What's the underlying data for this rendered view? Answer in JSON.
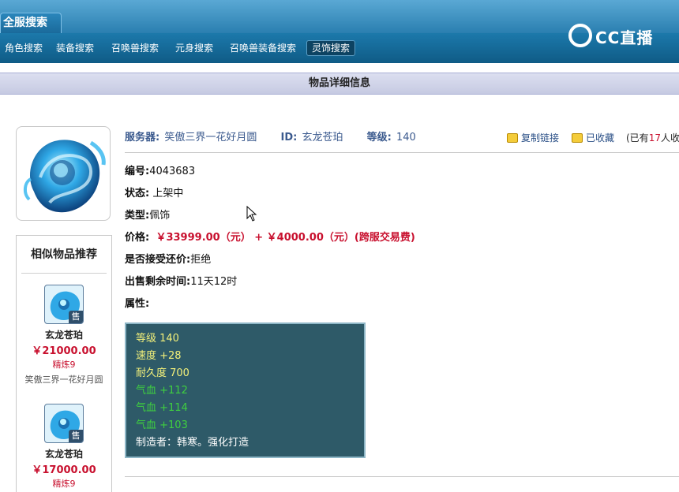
{
  "top_tab": "全服搜索",
  "logo_text": "CC直播",
  "nav": [
    {
      "label": "角色搜索"
    },
    {
      "label": "装备搜索"
    },
    {
      "label": "召唤兽搜索"
    },
    {
      "label": "元身搜索"
    },
    {
      "label": "召唤兽装备搜索"
    },
    {
      "label": "灵饰搜索",
      "active": true
    }
  ],
  "section_title": "物品详细信息",
  "info": {
    "server_label": "服务器:",
    "server_value": "笑傲三界一花好月圆",
    "id_label": "ID:",
    "id_value": "玄龙苍珀",
    "level_label": "等级:",
    "level_value": "140",
    "copy_link": "复制链接",
    "favorited": "已收藏",
    "fav_prefix": "(已有",
    "fav_count": "17",
    "fav_suffix": "人收藏"
  },
  "details": {
    "serial_label": "编号:",
    "serial_value": "4043683",
    "status_label": "状态:",
    "status_value": "上架中",
    "type_label": "类型:",
    "type_value": "佩饰",
    "price_label": "价格:",
    "price_value": "￥33999.00（元） +  ￥4000.00（元）(跨服交易费)",
    "counter_label": "是否接受还价:",
    "counter_value": "拒绝",
    "remaining_label": "出售剩余时间:",
    "remaining_value": "11天12时",
    "attr_label": "属性:"
  },
  "attributes": [
    {
      "text": "等级 140",
      "color": "#f3f07a"
    },
    {
      "text": "速度 +28",
      "color": "#f3f07a"
    },
    {
      "text": "耐久度 700",
      "color": "#f3f07a"
    },
    {
      "text": "气血 +112",
      "color": "#3fcf3f"
    },
    {
      "text": "气血 +114",
      "color": "#3fcf3f"
    },
    {
      "text": "气血 +103",
      "color": "#3fcf3f"
    },
    {
      "text": "制造者：韩寒。强化打造",
      "color": "#ffffff"
    }
  ],
  "recommend": {
    "title": "相似物品推荐",
    "items": [
      {
        "sell": "售",
        "name": "玄龙苍珀",
        "price": "￥21000.00",
        "refine": "精炼9",
        "server": "笑傲三界一花好月圆"
      },
      {
        "sell": "售",
        "name": "玄龙苍珀",
        "price": "￥17000.00",
        "refine": "精炼9"
      }
    ]
  }
}
